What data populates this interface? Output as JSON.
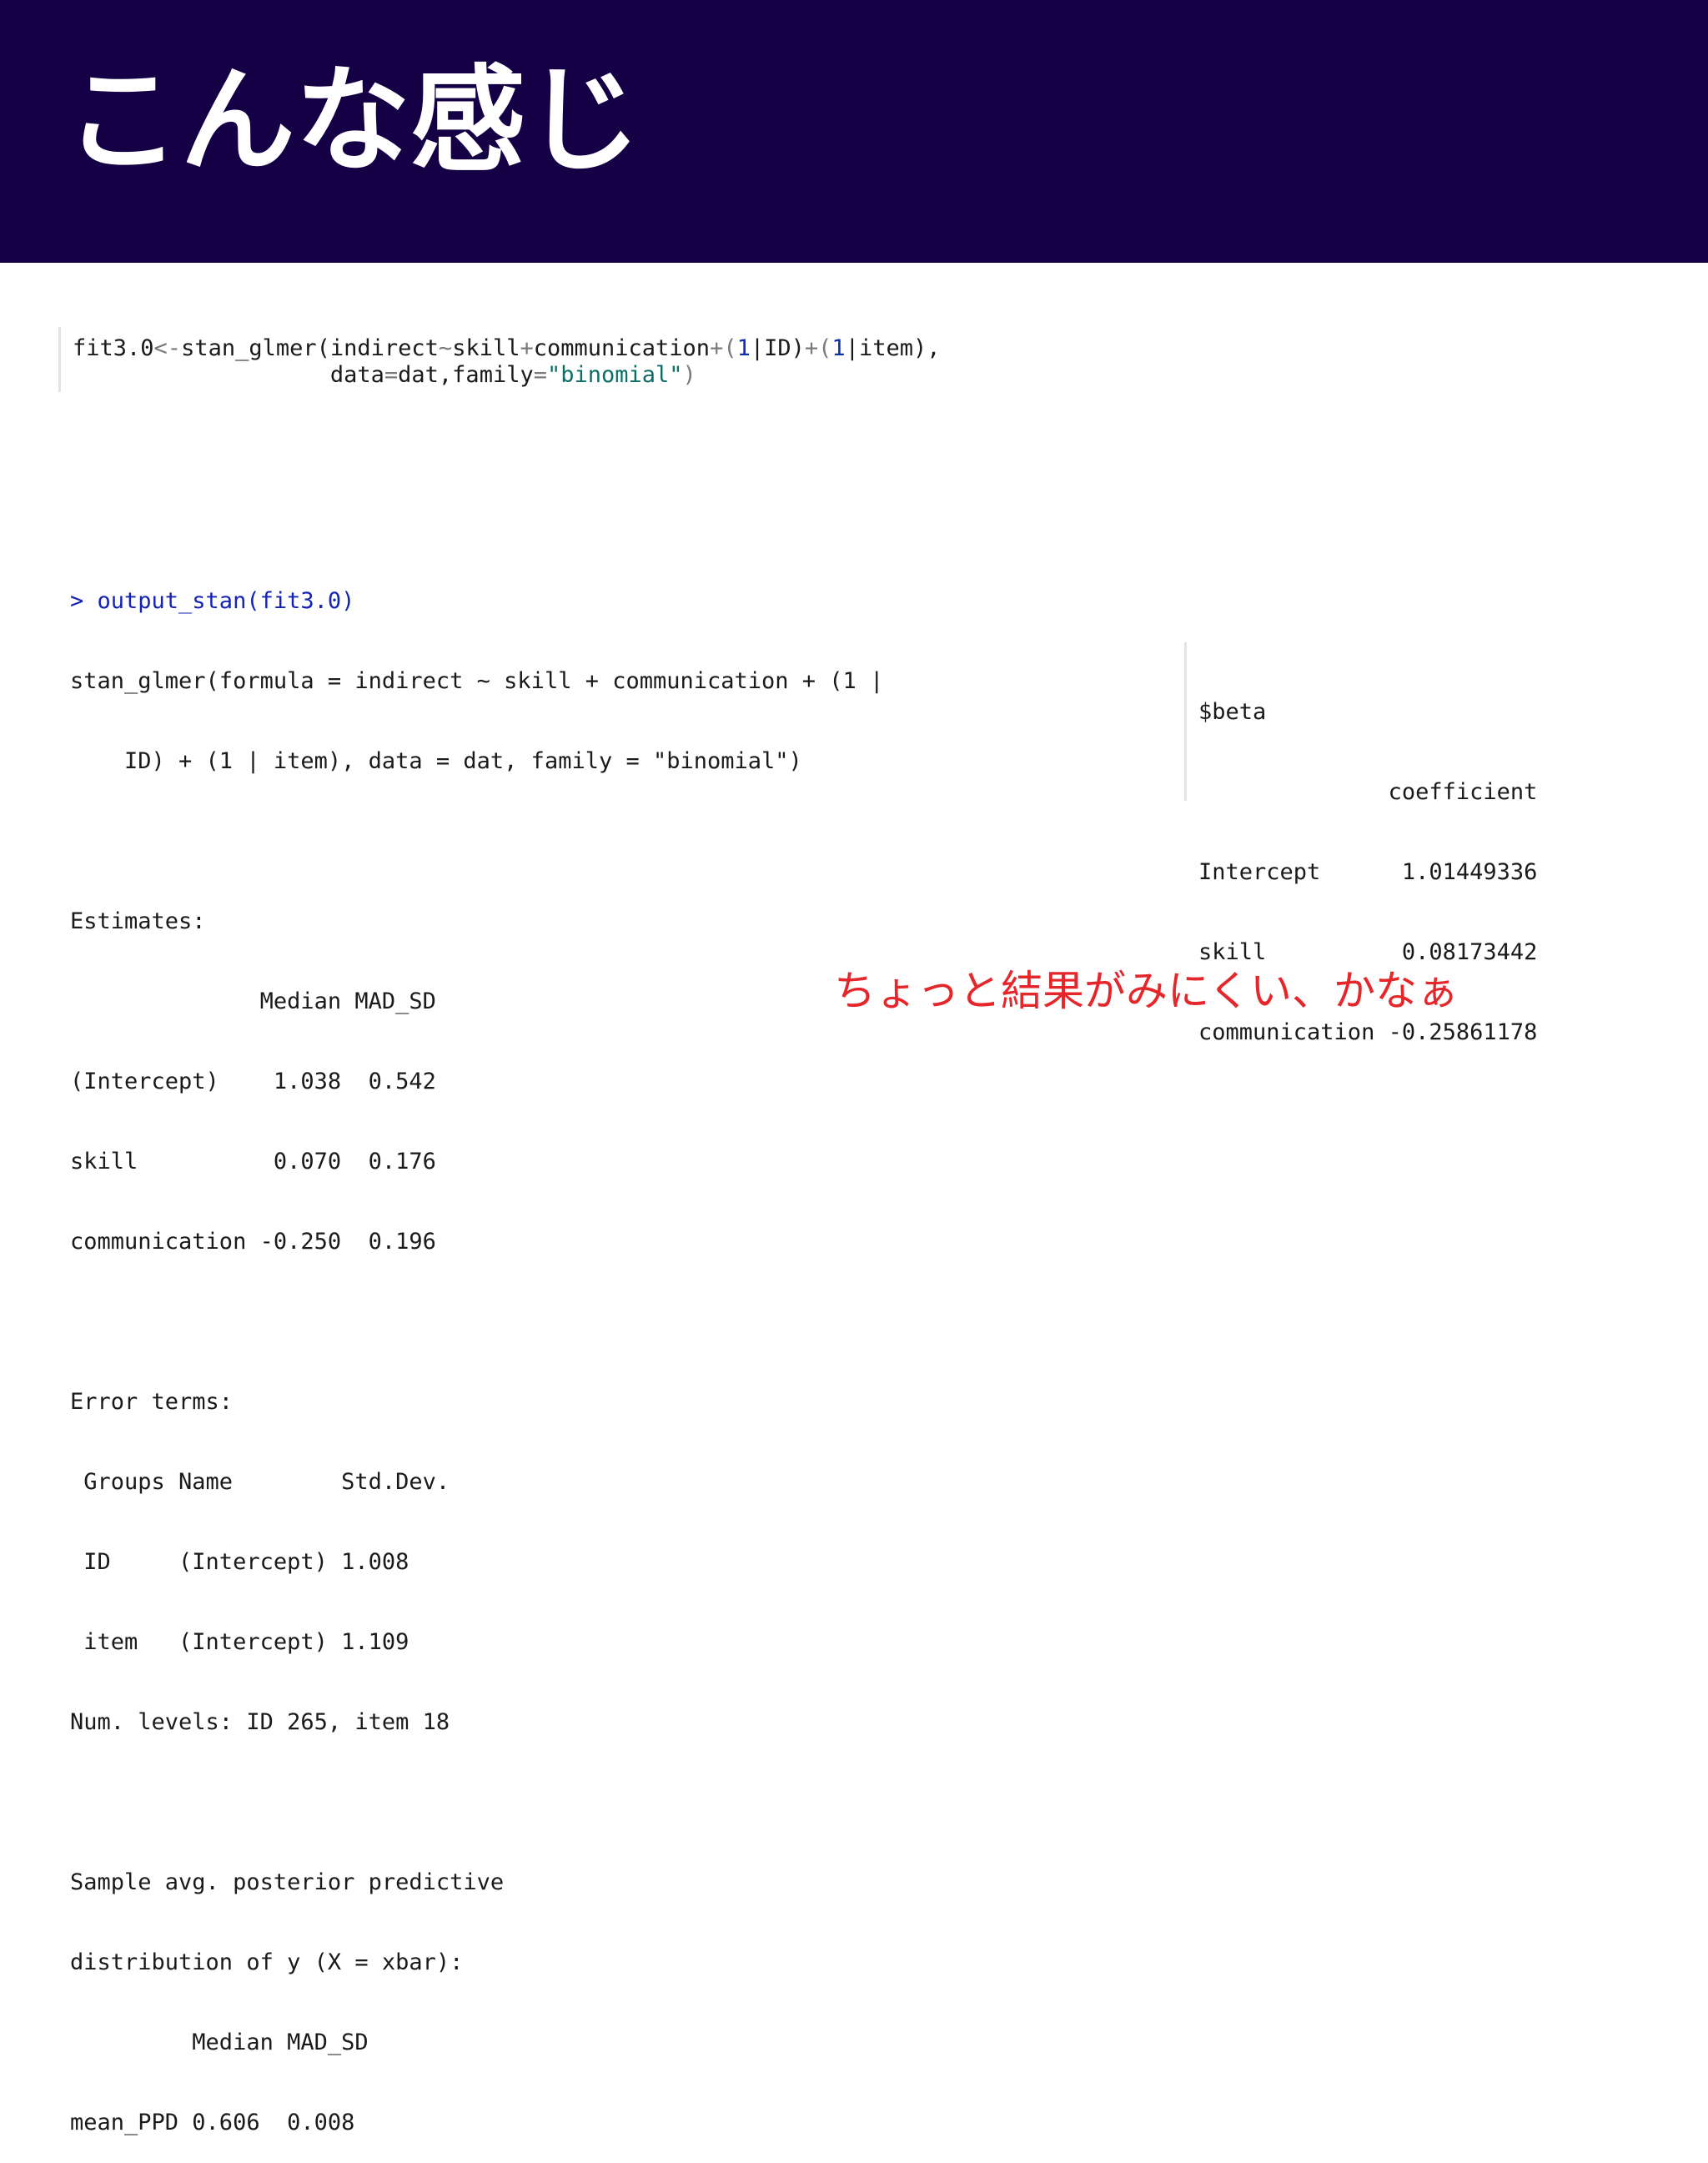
{
  "slide": {
    "title": "こんな感じ",
    "colors": {
      "header_bg": "#150046",
      "comment": "#e5262b",
      "prompt": "#1523b5"
    }
  },
  "code": {
    "line1": {
      "lhs": "fit3.0",
      "assign": "<-",
      "call": "stan_glmer(indirect",
      "tilde": "~",
      "t1": "skill",
      "plus1": "+",
      "t2": "communication",
      "plus2": "+",
      "p_open1": "(",
      "one1": "1",
      "bar1": "|ID)",
      "plus3": "+",
      "p_open2": "(",
      "one2": "1",
      "bar2": "|item),"
    },
    "line2": {
      "indent": "                   ",
      "data_arg": "data",
      "eq1": "=",
      "data_val": "dat,family",
      "eq2": "=",
      "family_val": "\"binomial\"",
      "close": ")"
    }
  },
  "console": {
    "prompt": "> output_stan(fit3.0)",
    "lines": [
      "stan_glmer(formula = indirect ~ skill + communication + (1 |",
      "    ID) + (1 | item), data = dat, family = \"binomial\")",
      "",
      "Estimates:",
      "              Median MAD_SD",
      "(Intercept)    1.038  0.542",
      "skill          0.070  0.176",
      "communication -0.250  0.196",
      "",
      "Error terms:",
      " Groups Name        Std.Dev.",
      " ID     (Intercept) 1.008",
      " item   (Intercept) 1.109",
      "Num. levels: ID 265, item 18",
      "",
      "Sample avg. posterior predictive",
      "distribution of y (X = xbar):",
      "         Median MAD_SD",
      "mean_PPD 0.606  0.008"
    ]
  },
  "beta": {
    "lines": [
      "$beta",
      "              coefficient",
      "Intercept      1.01449336",
      "skill          0.08173442",
      "communication -0.25861178"
    ]
  },
  "comment": "ちょっと結果がみにくい、かなぁ"
}
